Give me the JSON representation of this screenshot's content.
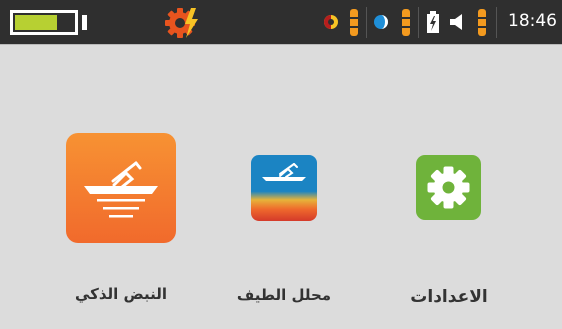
{
  "status": {
    "battery_level": 0.72,
    "time": "18:46",
    "accent_color": "#f39a1f"
  },
  "apps": [
    {
      "label": "النبض الذكي",
      "icon": "pulse-detector-icon",
      "selected": true
    },
    {
      "label": "محلل الطيف",
      "icon": "spectrum-analyzer-icon",
      "selected": false
    },
    {
      "label": "الاعدادات",
      "icon": "settings-gear-icon",
      "selected": false
    }
  ],
  "colors": {
    "background": "#dcdcdc",
    "statusbar": "#2f2f2f",
    "battery_fill": "#b7d032",
    "settings_green": "#6fb33b"
  }
}
